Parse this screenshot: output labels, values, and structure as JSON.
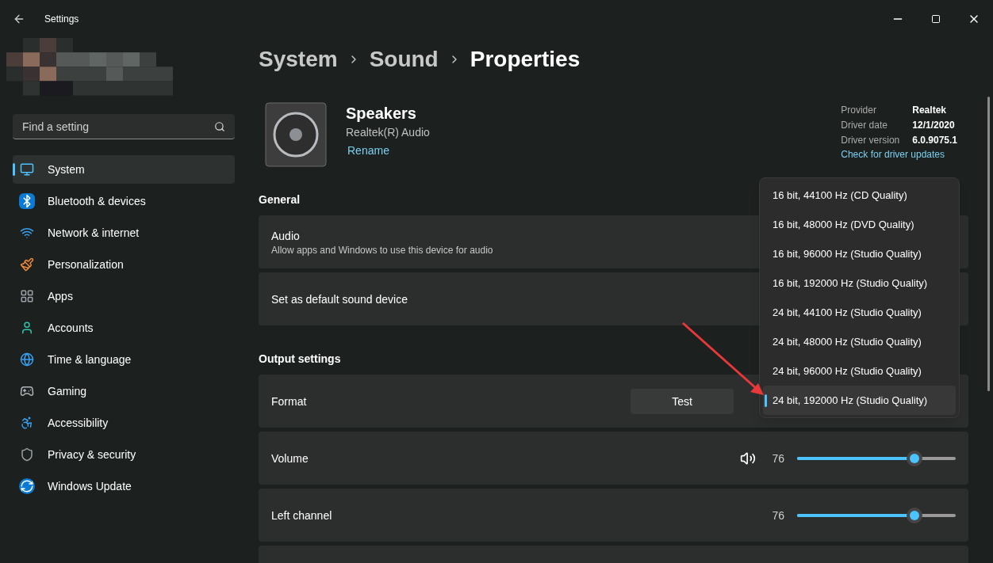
{
  "window": {
    "title": "Settings"
  },
  "search": {
    "placeholder": "Find a setting"
  },
  "sidebar": {
    "items": [
      {
        "label": "System",
        "selected": true,
        "kind": "system"
      },
      {
        "label": "Bluetooth & devices",
        "selected": false,
        "kind": "bluetooth"
      },
      {
        "label": "Network & internet",
        "selected": false,
        "kind": "network"
      },
      {
        "label": "Personalization",
        "selected": false,
        "kind": "brush"
      },
      {
        "label": "Apps",
        "selected": false,
        "kind": "apps"
      },
      {
        "label": "Accounts",
        "selected": false,
        "kind": "accounts"
      },
      {
        "label": "Time & language",
        "selected": false,
        "kind": "time"
      },
      {
        "label": "Gaming",
        "selected": false,
        "kind": "gaming"
      },
      {
        "label": "Accessibility",
        "selected": false,
        "kind": "accessibility"
      },
      {
        "label": "Privacy & security",
        "selected": false,
        "kind": "privacy"
      },
      {
        "label": "Windows Update",
        "selected": false,
        "kind": "update"
      }
    ]
  },
  "breadcrumb": [
    "System",
    "Sound",
    "Properties"
  ],
  "device": {
    "name": "Speakers",
    "subtitle": "Realtek(R) Audio",
    "rename": "Rename"
  },
  "driver": {
    "rows": [
      {
        "label": "Provider",
        "value": "Realtek"
      },
      {
        "label": "Driver date",
        "value": "12/1/2020"
      },
      {
        "label": "Driver version",
        "value": "6.0.9075.1"
      }
    ],
    "link": "Check for driver updates"
  },
  "sections": [
    {
      "heading": "General",
      "rows": [
        {
          "kind": "plain",
          "title": "Audio",
          "description": "Allow apps and Windows to use this device for audio"
        },
        {
          "kind": "plain",
          "title": "Set as default sound device"
        }
      ]
    },
    {
      "heading": "Output settings",
      "rows": [
        {
          "kind": "format",
          "title": "Format",
          "button": "Test"
        },
        {
          "kind": "slider",
          "title": "Volume",
          "speaker": true,
          "reading": "76",
          "level": 0.74
        },
        {
          "kind": "slider",
          "title": "Left channel",
          "speaker": false,
          "reading": "76",
          "level": 0.74
        },
        {
          "kind": "plain",
          "title": ""
        }
      ]
    }
  ],
  "format_menu": {
    "options": [
      {
        "label": "16 bit, 44100 Hz (CD Quality)",
        "selected": false
      },
      {
        "label": "16 bit, 48000 Hz (DVD Quality)",
        "selected": false
      },
      {
        "label": "16 bit, 96000 Hz (Studio Quality)",
        "selected": false
      },
      {
        "label": "16 bit, 192000 Hz (Studio Quality)",
        "selected": false
      },
      {
        "label": "24 bit, 44100 Hz (Studio Quality)",
        "selected": false
      },
      {
        "label": "24 bit, 48000 Hz (Studio Quality)",
        "selected": false
      },
      {
        "label": "24 bit, 96000 Hz (Studio Quality)",
        "selected": false
      },
      {
        "label": "24 bit, 192000 Hz (Studio Quality)",
        "selected": true
      }
    ]
  }
}
